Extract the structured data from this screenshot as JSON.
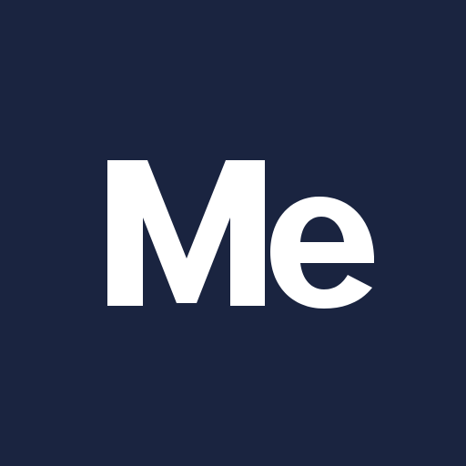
{
  "app_icon": {
    "logo_text": "Me",
    "background_color": "#1a2440",
    "glyph_color": "#ffffff"
  }
}
